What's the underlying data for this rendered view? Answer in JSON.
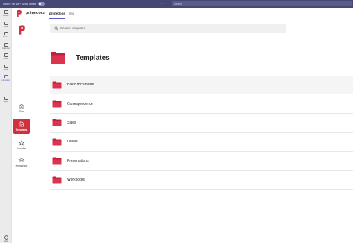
{
  "titlebar": {
    "text": "Switch: Ctrl Alt + Arrow Tenant",
    "search_placeholder": "Search"
  },
  "rail": {
    "items": [
      {
        "label": "Activity",
        "icon": "bell-icon"
      },
      {
        "label": "Chat",
        "icon": "chat-icon"
      },
      {
        "label": "Teams",
        "icon": "teams-icon"
      },
      {
        "label": "Calendar",
        "icon": "calendar-icon"
      },
      {
        "label": "Calls",
        "icon": "phone-icon"
      },
      {
        "label": "Files",
        "icon": "file-icon"
      },
      {
        "label": "primedocs",
        "icon": "primedocs-icon"
      },
      {
        "label": "Apps",
        "icon": "apps-icon"
      }
    ],
    "more": "···",
    "help_label": "Help"
  },
  "header": {
    "app_name": "primedocs",
    "tabs": [
      "primedocs",
      "Info"
    ]
  },
  "nav": {
    "items": [
      {
        "label": "Start",
        "icon": "home-icon"
      },
      {
        "label": "Templates",
        "icon": "template-icon",
        "active": true
      },
      {
        "label": "Favorites",
        "icon": "star-icon"
      },
      {
        "label": "Knowledge",
        "icon": "graduation-cap-icon"
      }
    ]
  },
  "search": {
    "placeholder": "Search templates"
  },
  "page": {
    "title": "Templates"
  },
  "folders": [
    {
      "label": "Basic documents"
    },
    {
      "label": "Correspondence"
    },
    {
      "label": "Sales"
    },
    {
      "label": "Labels"
    },
    {
      "label": "Presentations"
    },
    {
      "label": "Workbooks"
    }
  ],
  "colors": {
    "brand": "#d0313d",
    "teams_purple": "#464775",
    "accent": "#5b5fc7"
  }
}
